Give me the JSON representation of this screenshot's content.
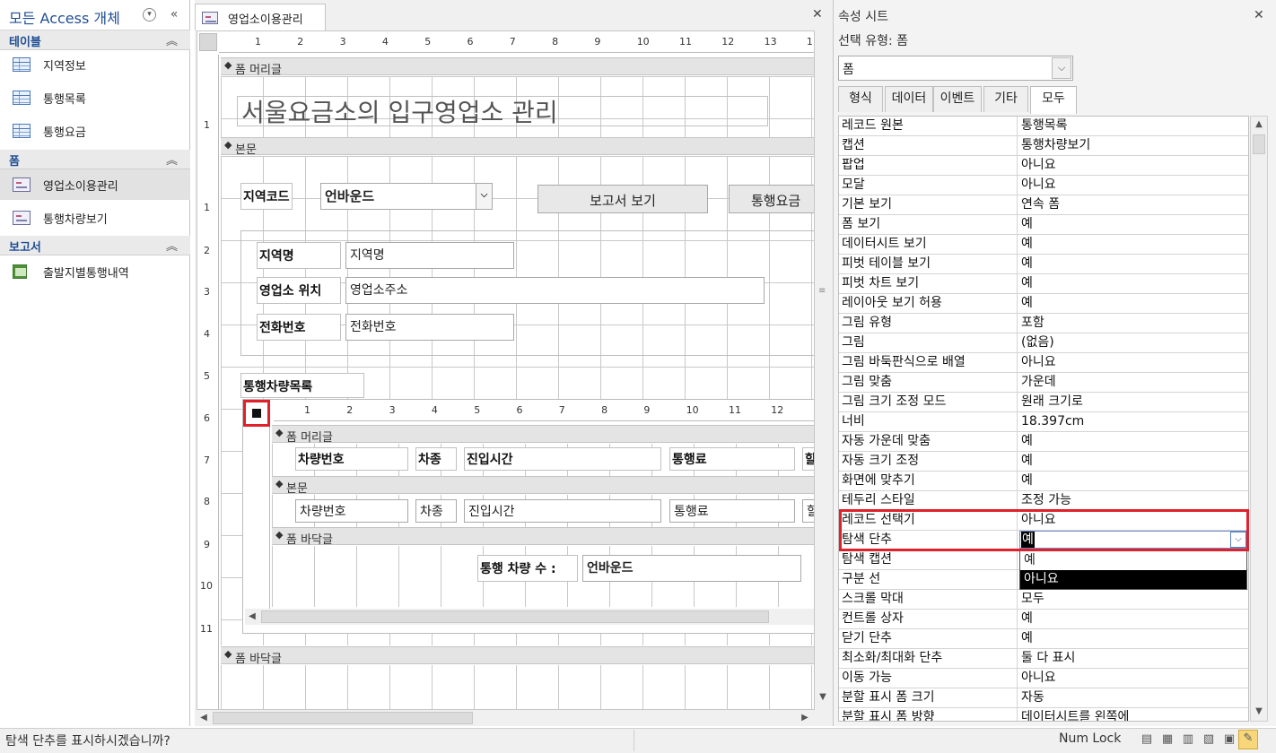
{
  "nav": {
    "title": "모든 Access 개체",
    "groups": [
      {
        "label": "테이블",
        "items": [
          "지역정보",
          "통행목록",
          "통행요금"
        ]
      },
      {
        "label": "폼",
        "items": [
          "영업소이용관리",
          "통행차량보기"
        ]
      },
      {
        "label": "보고서",
        "items": [
          "출발지별통행내역"
        ]
      }
    ]
  },
  "doc": {
    "tab": "영업소이용관리",
    "ruler": [
      "1",
      "2",
      "3",
      "4",
      "5",
      "6",
      "7",
      "8",
      "9",
      "10",
      "11",
      "12",
      "13",
      "1"
    ],
    "vruler": [
      "1",
      "1",
      "2",
      "3",
      "4",
      "5",
      "6",
      "7",
      "8",
      "9",
      "10",
      "11"
    ],
    "bands": {
      "header": "폼 머리글",
      "detail": "본문",
      "footer": "폼 바닥글"
    },
    "title": "서울요금소의 입구영업소 관리",
    "region_label": "지역코드",
    "region_value": "언바운드",
    "report_button": "보고서 보기",
    "toll_button": "통행요금",
    "fields": [
      {
        "label": "지역명",
        "value": "지역명"
      },
      {
        "label": "영업소 위치",
        "value": "영업소주소"
      },
      {
        "label": "전화번호",
        "value": "전화번호"
      }
    ],
    "subform_label": "통행차량목록",
    "subform": {
      "ruler": [
        "1",
        "2",
        "3",
        "4",
        "5",
        "6",
        "7",
        "8",
        "9",
        "10",
        "11",
        "12"
      ],
      "bands": {
        "header": "폼 머리글",
        "detail": "본문",
        "footer": "폼 바닥글"
      },
      "header_labels": [
        "차량번호",
        "차종",
        "진입시간",
        "통행료",
        "할"
      ],
      "detail_fields": [
        "차량번호",
        "차종",
        "진입시간",
        "통행료",
        "할"
      ],
      "count_label": "통행 차량 수 :",
      "count_value": "언바운드"
    }
  },
  "props": {
    "title": "속성 시트",
    "selection_type": "선택 유형: 폼",
    "selection": "폼",
    "tabs": [
      "형식",
      "데이터",
      "이벤트",
      "기타",
      "모두"
    ],
    "active_tab": "모두",
    "rows": [
      {
        "name": "레코드 원본",
        "value": "통행목록"
      },
      {
        "name": "캡션",
        "value": "통행차량보기"
      },
      {
        "name": "팝업",
        "value": "아니요"
      },
      {
        "name": "모달",
        "value": "아니요"
      },
      {
        "name": "기본 보기",
        "value": "연속 폼"
      },
      {
        "name": "폼 보기",
        "value": "예"
      },
      {
        "name": "데이터시트 보기",
        "value": "예"
      },
      {
        "name": "피벗 테이블 보기",
        "value": "예"
      },
      {
        "name": "피벗 차트 보기",
        "value": "예"
      },
      {
        "name": "레이아웃 보기 허용",
        "value": "예"
      },
      {
        "name": "그림 유형",
        "value": "포함"
      },
      {
        "name": "그림",
        "value": "(없음)"
      },
      {
        "name": "그림 바둑판식으로 배열",
        "value": "아니요"
      },
      {
        "name": "그림 맞춤",
        "value": "가운데"
      },
      {
        "name": "그림 크기 조정 모드",
        "value": "원래 크기로"
      },
      {
        "name": "너비",
        "value": "18.397cm"
      },
      {
        "name": "자동 가운데 맞춤",
        "value": "예"
      },
      {
        "name": "자동 크기 조정",
        "value": "예"
      },
      {
        "name": "화면에 맞추기",
        "value": "예"
      },
      {
        "name": "테두리 스타일",
        "value": "조정 가능"
      },
      {
        "name": "레코드 선택기",
        "value": "아니요"
      },
      {
        "name": "탐색 단추",
        "value": ""
      },
      {
        "name": "탐색 캡션",
        "value": ""
      },
      {
        "name": "구분 선",
        "value": ""
      },
      {
        "name": "스크롤 막대",
        "value": "모두"
      },
      {
        "name": "컨트롤 상자",
        "value": "예"
      },
      {
        "name": "닫기 단추",
        "value": "예"
      },
      {
        "name": "최소화/최대화 단추",
        "value": "둘 다 표시"
      },
      {
        "name": "이동 가능",
        "value": "아니요"
      },
      {
        "name": "분할 표시 폼 크기",
        "value": "자동"
      },
      {
        "name": "분할 표시 폼 방향",
        "value": "데이터시트를 왼쪽에"
      }
    ],
    "nav_buttons_value": "예",
    "dropdown_options": [
      "예",
      "아니요"
    ],
    "highlight_color": "#e0202a"
  },
  "status": {
    "message": "탐색 단추를 표시하시겠습니까?",
    "numlock": "Num Lock"
  }
}
